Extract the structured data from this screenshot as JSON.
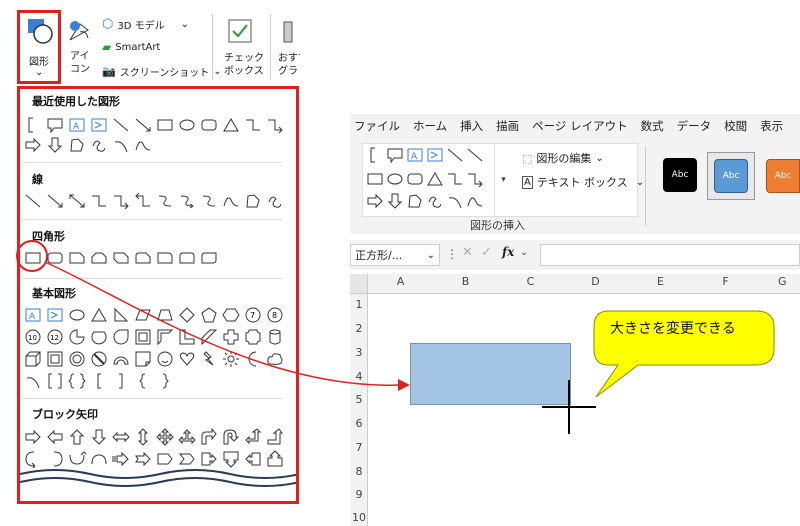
{
  "ribbon": {
    "shapes_label": "図形",
    "icons_label": "アイ\nコン",
    "models3d_label": "3D モデル",
    "smartart_label": "SmartArt",
    "screenshot_label": "スクリーンショット",
    "checkbox_label": "チェック\nボックス",
    "recommended_label": "おすす\nグラ"
  },
  "gallery": {
    "recent_title": "最近使用した図形",
    "lines_title": "線",
    "rect_title": "四角形",
    "basic_title": "基本図形",
    "arrows_title": "ブロック矢印"
  },
  "excel": {
    "menu": [
      "ファイル",
      "ホーム",
      "挿入",
      "描画",
      "ページ レイアウト",
      "数式",
      "データ",
      "校閲",
      "表示"
    ],
    "edit_shape": "図形の編集",
    "textbox": "テキスト ボックス",
    "insert_shapes_group": "図形の挿入",
    "style_label": "Abc",
    "name_box": "正方形/...",
    "fx": "fx",
    "columns": [
      "A",
      "B",
      "C",
      "D",
      "E",
      "F",
      "G"
    ],
    "rows": [
      "1",
      "2",
      "3",
      "4",
      "5",
      "6",
      "7",
      "8",
      "9",
      "10"
    ],
    "callout_text": "大きさを変更できる"
  },
  "colors": {
    "highlight": "#e02020",
    "shape_fill": "#a4c4e6",
    "callout_fill": "#ffff00",
    "style_blue": "#5b9bd5",
    "style_orange": "#ed7d31"
  }
}
